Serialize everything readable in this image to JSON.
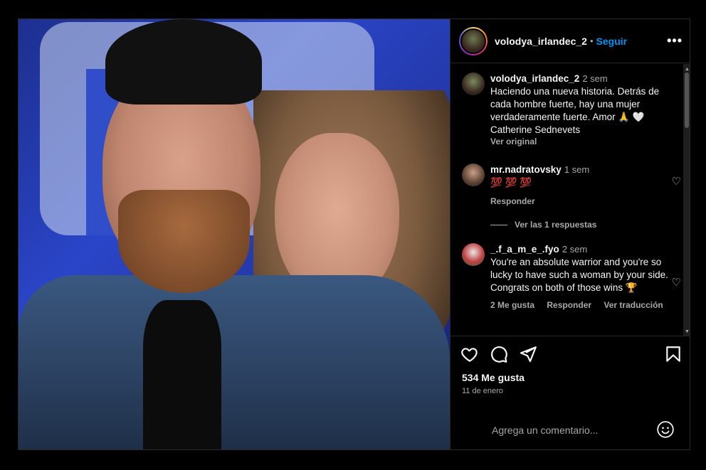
{
  "post": {
    "username": "volodya_irlandec_2",
    "dot": "•",
    "follow_label": "Seguir",
    "more_label": "•••",
    "likes": "534 Me gusta",
    "date": "11 de enero",
    "add_comment_placeholder": "Agrega un comentario..."
  },
  "caption": {
    "username": "volodya_irlandec_2",
    "time": "2 sem",
    "text": "Haciendo una nueva historia. Detrás de cada hombre fuerte, hay una mujer verdaderamente fuerte. Amor 🙏 🤍 Catherine Sednevets",
    "see_original": "Ver original"
  },
  "comments": [
    {
      "username": "mr.nadratovsky",
      "time": "1 sem",
      "text": "💯 💯 💯",
      "reply_label": "Responder",
      "view_replies": "Ver las 1 respuestas"
    },
    {
      "username": "_.f_a_m_e_.fyo",
      "time": "2 sem",
      "text": "You're an absolute warrior and you're so lucky to have such a woman by your side. Congrats on both of those wins 🏆",
      "likes_label": "2 Me gusta",
      "reply_label": "Responder",
      "translate_label": "Ver traducción"
    }
  ],
  "icons": [
    "like-icon",
    "comment-icon",
    "share-icon",
    "save-icon",
    "emoji-icon",
    "heart-icon",
    "more-icon"
  ],
  "colors": {
    "accent": "#0095f6",
    "background": "#000000",
    "muted": "#a8a8a8"
  }
}
